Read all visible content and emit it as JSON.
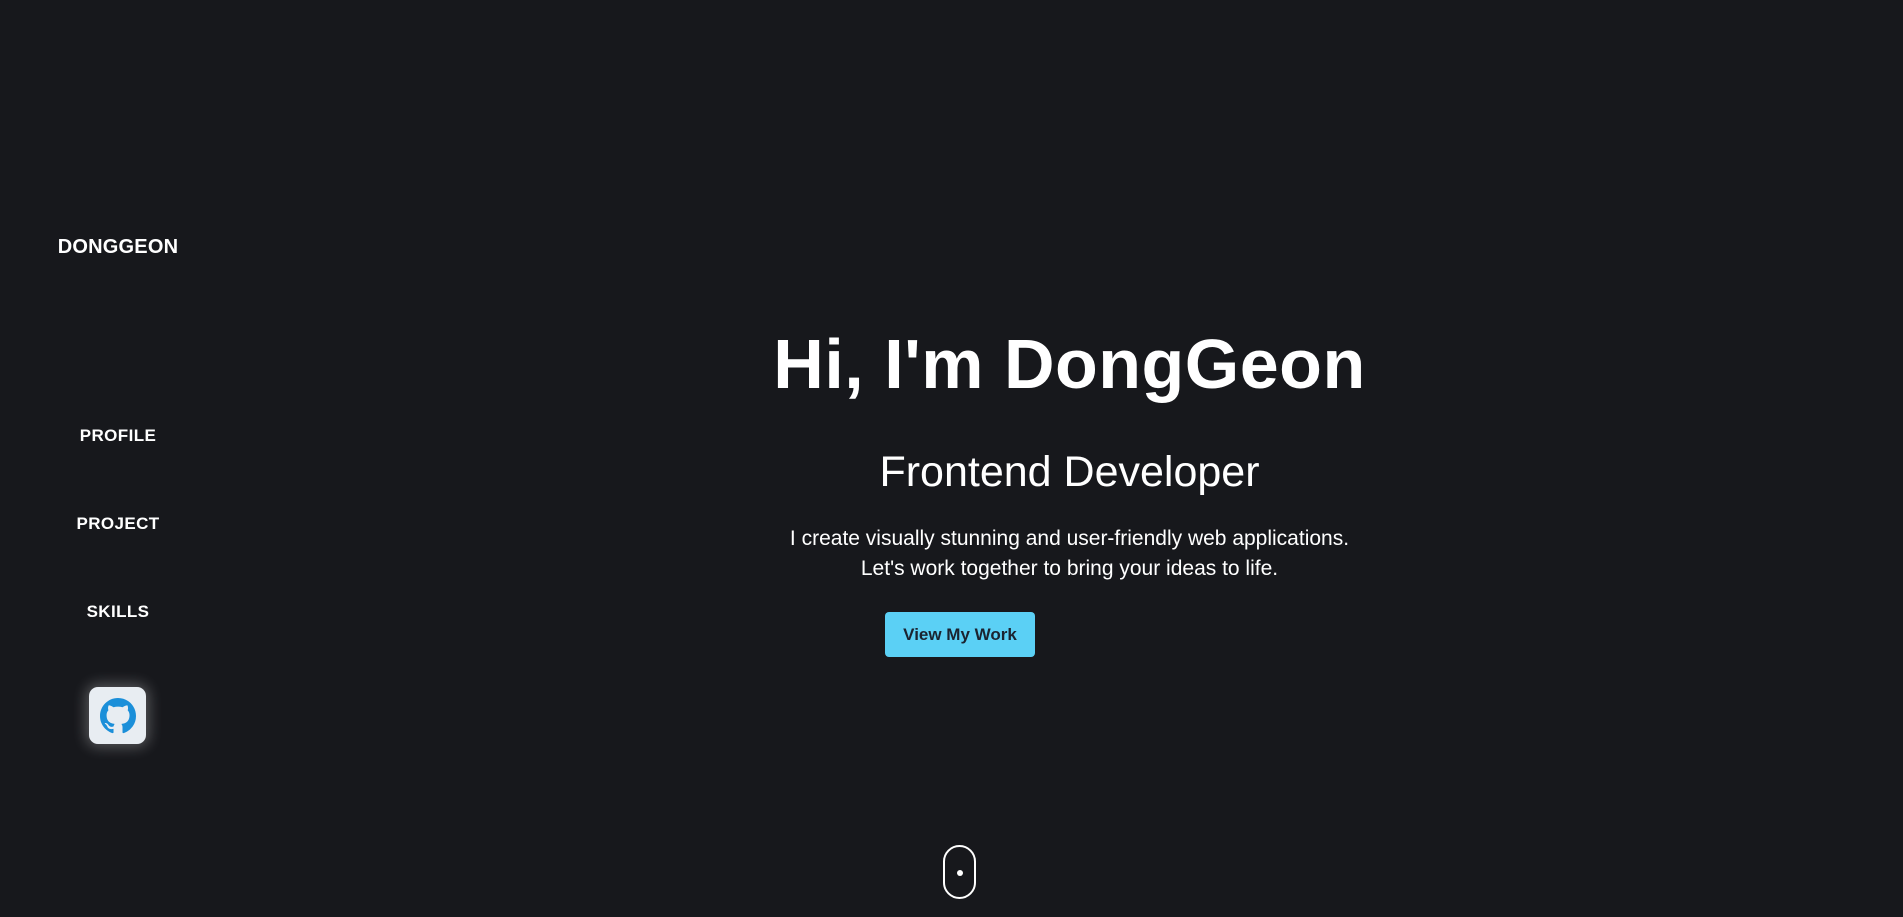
{
  "sidebar": {
    "logo": "DONGGEON",
    "nav": [
      {
        "label": "PROFILE"
      },
      {
        "label": "PROJECT"
      },
      {
        "label": "SKILLS"
      }
    ],
    "github_icon": "github-icon"
  },
  "hero": {
    "title": "Hi, I'm DongGeon",
    "subtitle": "Frontend Developer",
    "description_line1": "I create visually stunning and user-friendly web applications.",
    "description_line2": "Let's work together to bring your ideas to life.",
    "cta_label": "View My Work"
  },
  "scroll_indicator_icon": "mouse-scroll-icon",
  "colors": {
    "background": "#17181c",
    "accent": "#5bd0f5",
    "github_icon": "#1b8fd9",
    "text": "#ffffff"
  }
}
